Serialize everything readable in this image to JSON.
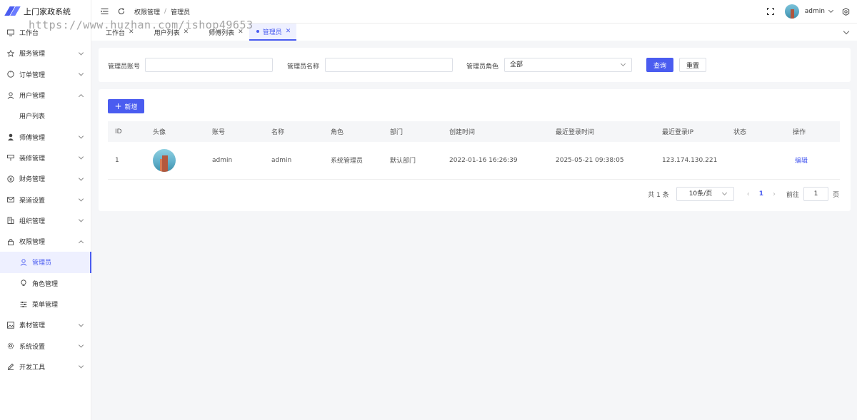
{
  "app": {
    "title": "上门家政系统"
  },
  "watermark": "https://www.huzhan.com/ishop49653",
  "sidebar": {
    "items": [
      {
        "label": "工作台",
        "icon": "monitor-icon"
      },
      {
        "label": "服务管理",
        "icon": "star-icon"
      },
      {
        "label": "订单管理",
        "icon": "clock-icon"
      },
      {
        "label": "用户管理",
        "icon": "user-icon",
        "expanded": true
      },
      {
        "label": "用户列表"
      },
      {
        "label": "师傅管理",
        "icon": "worker-icon"
      },
      {
        "label": "装修管理",
        "icon": "decoration-icon"
      },
      {
        "label": "财务管理",
        "icon": "finance-icon"
      },
      {
        "label": "渠道设置",
        "icon": "mail-icon"
      },
      {
        "label": "组织管理",
        "icon": "building-icon"
      },
      {
        "label": "权限管理",
        "icon": "lock-icon",
        "expanded": true
      },
      {
        "label": "管理员",
        "icon": "person-icon",
        "active": true
      },
      {
        "label": "角色管理",
        "icon": "bulb-icon"
      },
      {
        "label": "菜单管理",
        "icon": "sliders-icon"
      },
      {
        "label": "素材管理",
        "icon": "image-icon"
      },
      {
        "label": "系统设置",
        "icon": "gear-icon"
      },
      {
        "label": "开发工具",
        "icon": "pen-icon"
      }
    ]
  },
  "header": {
    "breadcrumb": [
      "权限管理",
      "管理员"
    ],
    "user": "admin"
  },
  "tabs": [
    {
      "label": "工作台"
    },
    {
      "label": "用户列表"
    },
    {
      "label": "师傅列表"
    },
    {
      "label": "管理员",
      "active": true
    }
  ],
  "filter": {
    "account_label": "管理员账号",
    "name_label": "管理员名称",
    "role_label": "管理员角色",
    "role_value": "全部",
    "search_label": "查询",
    "reset_label": "重置"
  },
  "table": {
    "add_label": "新增",
    "columns": [
      "ID",
      "头像",
      "账号",
      "名称",
      "角色",
      "部门",
      "创建时间",
      "最近登录时间",
      "最近登录IP",
      "状态",
      "操作"
    ],
    "rows": [
      {
        "id": "1",
        "account": "admin",
        "name": "admin",
        "role": "系统管理员",
        "dept": "默认部门",
        "created": "2022-01-16 16:26:39",
        "last_login": "2025-05-21 09:38:05",
        "ip": "123.174.130.221",
        "status": "",
        "action": "编辑"
      }
    ]
  },
  "pagination": {
    "total": "共 1 条",
    "page_size": "10条/页",
    "current": "1",
    "goto_label": "前往",
    "goto_value": "1",
    "page_suffix": "页"
  },
  "colors": {
    "primary": "#4a5cf0"
  }
}
